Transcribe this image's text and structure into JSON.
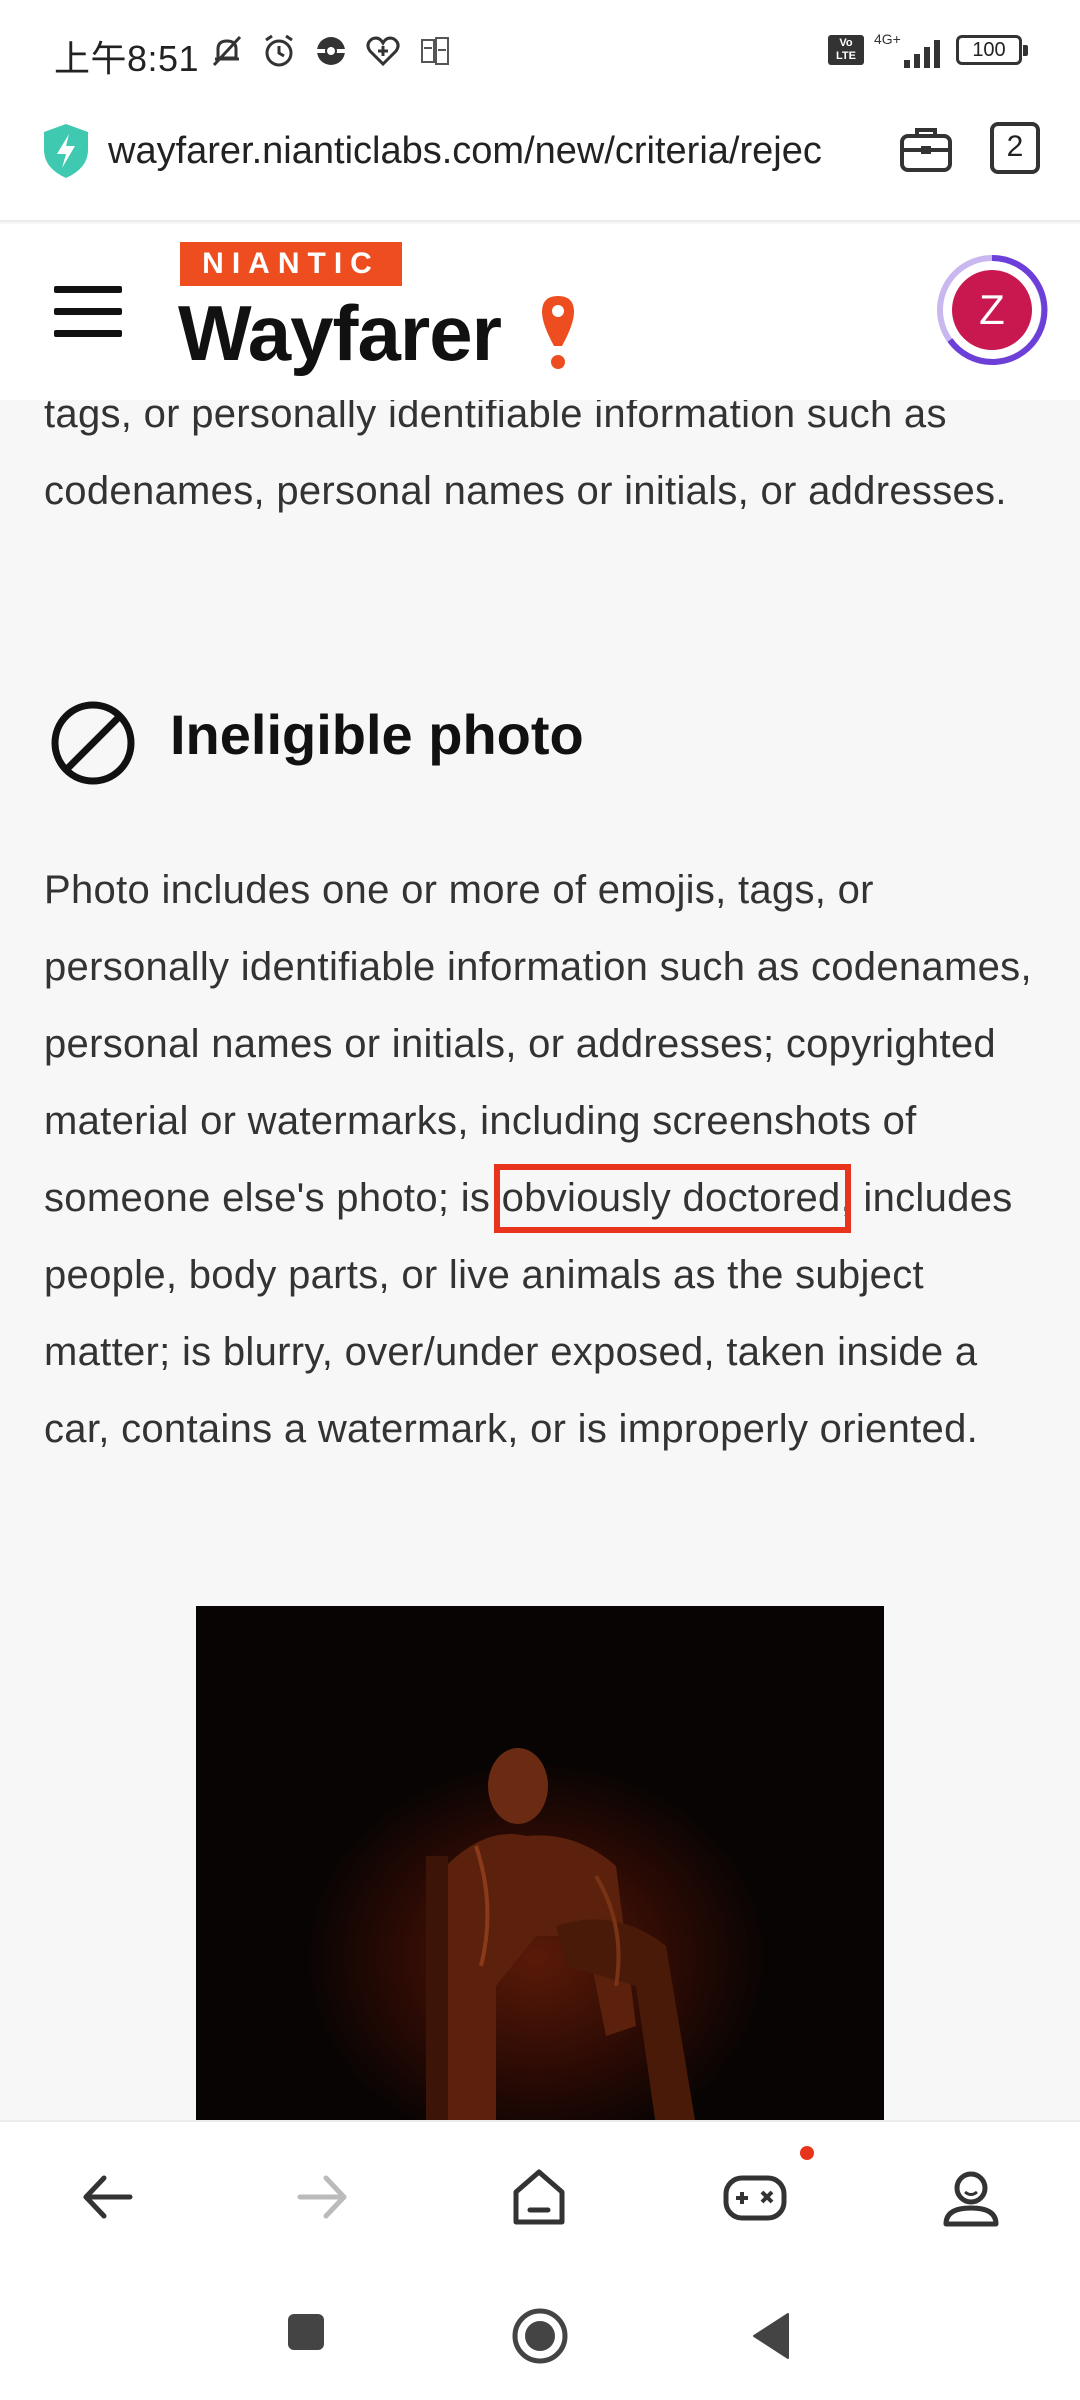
{
  "status_bar": {
    "time": "上午8:51",
    "volte": "Vo\nLTE",
    "network": "4G+",
    "battery": "100"
  },
  "browser": {
    "url": "wayfarer.nianticlabs.com/new/criteria/rejec",
    "tab_count": "2"
  },
  "header": {
    "brand_top": "NIANTIC",
    "brand_name": "Wayfarer",
    "avatar_letter": "Z"
  },
  "content": {
    "intro_paragraph": "tags, or personally identifiable information such as codenames, personal names or initials, or addresses.",
    "section_title": "Ineligible photo",
    "body_before": "Photo includes one or more of emojis, tags, or personally identifiable information such as codenames, personal names or initials, or addresses; copyrighted material or watermarks, including screenshots of someone else's photo; is ",
    "body_highlight": "obviously doctored",
    "body_after": ", includes people, body parts, or live animals as the subject matter; is blurry, over/under exposed, taken inside a car, contains a watermark, or is improperly oriented."
  },
  "colors": {
    "niantic_orange": "#ee4e1f",
    "highlight_red": "#e8341c",
    "avatar_fill": "#c8184f",
    "avatar_ring": "#6b3fd8",
    "shield_teal": "#3ec9b0"
  },
  "icons": {
    "browser_nav": [
      "back-arrow-icon",
      "forward-arrow-icon",
      "home-icon",
      "game-controller-icon",
      "profile-icon"
    ],
    "system_nav": [
      "recents-square-icon",
      "home-circle-icon",
      "back-triangle-icon"
    ]
  }
}
